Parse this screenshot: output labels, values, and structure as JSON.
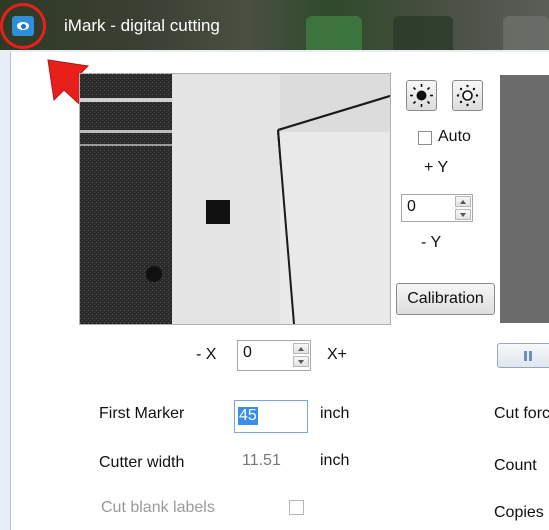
{
  "window": {
    "title": "iMark - digital cutting"
  },
  "camera_controls": {
    "auto_label": "Auto",
    "plus_y_label": "+ Y",
    "y_value": "0",
    "minus_y_label": "- Y",
    "calibration_label": "Calibration",
    "minus_x_label": "- X",
    "x_value": "0",
    "plus_x_label": "X+"
  },
  "settings": {
    "first_marker_label": "First Marker",
    "first_marker_value": "45",
    "first_marker_unit": "inch",
    "cutter_width_label": "Cutter width",
    "cutter_width_value": "11.51",
    "cutter_width_unit": "inch",
    "cut_blank_labels": "Cut blank labels"
  },
  "right_panel": {
    "cut_force_label": "Cut forc",
    "count_label": "Count",
    "copies_label": "Copies"
  },
  "colors": {
    "annotation": "#e8201c",
    "selection": "#3a8ee6"
  }
}
